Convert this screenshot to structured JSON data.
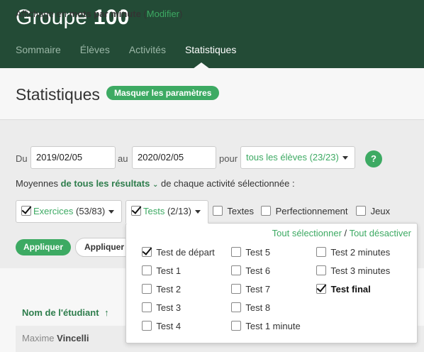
{
  "header": {
    "group_title_word": "Groupe",
    "group_title_number": "100",
    "nav": [
      "Sommaire",
      "Élèves",
      "Activités",
      "Statistiques"
    ]
  },
  "stats": {
    "title": "Statistiques",
    "toggle_params": "Masquer les paramètres"
  },
  "settings": {
    "display_prefix": "Affichage en",
    "display_unit": "mots par minute",
    "modify_open": "(",
    "modify_link": "Modifier",
    "modify_close": ")",
    "du": "Du",
    "date_from": "2019/02/05",
    "au": "au",
    "date_to": "2020/02/05",
    "pour": "pour",
    "students_select": "tous les élèves (23/23)",
    "help": "?",
    "avg_prefix": "Moyennes",
    "avg_scope": "de tous les résultats",
    "avg_suffix": "de chaque activité sélectionnée :",
    "filters": {
      "exercices_label": "Exercices",
      "exercices_count": "(53/83)",
      "tests_label": "Tests",
      "tests_count": "(2/13)",
      "textes": "Textes",
      "perfectionnement": "Perfectionnement",
      "jeux": "Jeux"
    },
    "apply": "Appliquer",
    "apply2": "Appliquer"
  },
  "popup": {
    "select_all": "Tout sélectionner",
    "separator": "/",
    "deselect_all": "Tout désactiver",
    "tests": [
      {
        "label": "Test de départ",
        "checked": true
      },
      {
        "label": "Test 1",
        "checked": false
      },
      {
        "label": "Test 2",
        "checked": false
      },
      {
        "label": "Test 3",
        "checked": false
      },
      {
        "label": "Test 4",
        "checked": false
      },
      {
        "label": "Test 5",
        "checked": false
      },
      {
        "label": "Test 6",
        "checked": false
      },
      {
        "label": "Test 7",
        "checked": false
      },
      {
        "label": "Test 8",
        "checked": false
      },
      {
        "label": "Test 1 minute",
        "checked": false
      },
      {
        "label": "Test 2 minutes",
        "checked": false
      },
      {
        "label": "Test 3 minutes",
        "checked": false
      },
      {
        "label": "Test final",
        "checked": true
      }
    ]
  },
  "table": {
    "col_student": "Nom de l'étudiant",
    "sort_arrow": "↑",
    "student_first": "Maxime",
    "student_last": "Vincelli"
  }
}
